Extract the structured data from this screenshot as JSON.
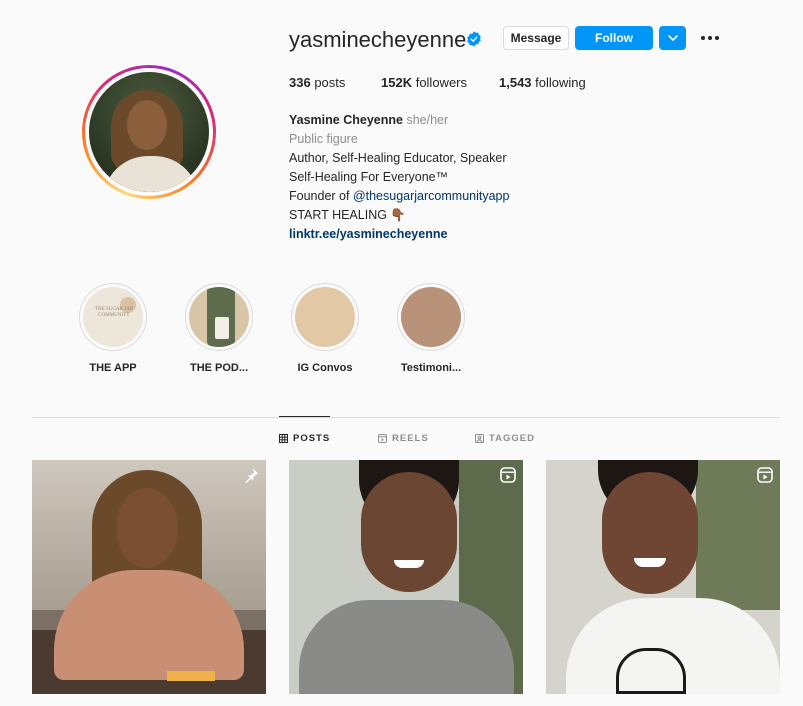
{
  "profile": {
    "username": "yasminecheyenne",
    "verified": true,
    "buttons": {
      "message": "Message",
      "follow": "Follow"
    }
  },
  "stats": {
    "posts_count": "336",
    "posts_label": "posts",
    "followers_count": "152K",
    "followers_label": "followers",
    "following_count": "1,543",
    "following_label": "following"
  },
  "bio": {
    "name": "Yasmine Cheyenne",
    "pronouns": "she/her",
    "category": "Public figure",
    "line1": "Author, Self-Healing Educator, Speaker",
    "line2": "Self-Healing For Everyone™",
    "line3_prefix": "Founder of ",
    "line3_mention": "@thesugarjarcommunityapp",
    "line4": "START HEALING 👇🏾",
    "link": "linktr.ee/yasminecheyenne"
  },
  "highlights": [
    {
      "label": "THE APP",
      "logo_text": "THE SUGAR JAR COMMUNITY",
      "bg": "#ede6da"
    },
    {
      "label": "THE POD...",
      "bg": "#d9c6a8"
    },
    {
      "label": "IG Convos",
      "bg": "#e3c8a6"
    },
    {
      "label": "Testimoni...",
      "bg": "#b8937a"
    }
  ],
  "tabs": [
    {
      "label": "POSTS",
      "icon": "grid-icon",
      "active": true
    },
    {
      "label": "REELS",
      "icon": "reels-icon",
      "active": false
    },
    {
      "label": "TAGGED",
      "icon": "tagged-icon",
      "active": false
    }
  ],
  "posts": [
    {
      "overlay_icon": "pin-icon"
    },
    {
      "overlay_icon": "reels-icon"
    },
    {
      "overlay_icon": "reels-icon"
    }
  ],
  "colors": {
    "accent": "#0095f6",
    "link": "#00376b",
    "muted": "#8e8e8e",
    "border": "#dbdbdb",
    "background": "#fafafa"
  }
}
